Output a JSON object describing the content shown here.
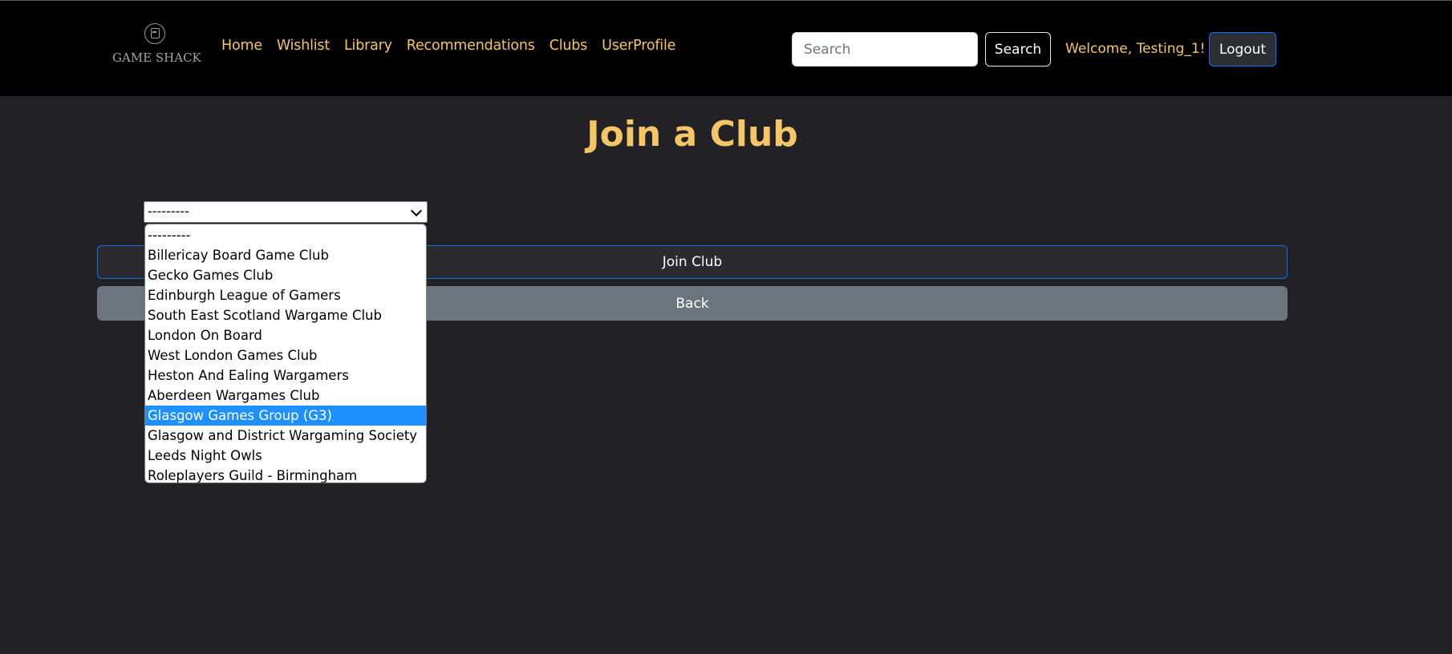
{
  "navbar": {
    "logo_text": "GAME SHACK",
    "links": [
      "Home",
      "Wishlist",
      "Library",
      "Recommendations",
      "Clubs",
      "UserProfile"
    ],
    "search_placeholder": "Search",
    "search_button": "Search",
    "welcome": "Welcome, Testing_1!",
    "logout": "Logout"
  },
  "main": {
    "title": "Join a Club",
    "select_value": "---------",
    "join_button": "Join Club",
    "back_button": "Back"
  },
  "dropdown": {
    "options": [
      "---------",
      "Billericay Board Game Club",
      "Gecko Games Club",
      "Edinburgh League of Gamers",
      "South East Scotland Wargame Club",
      "London On Board",
      "West London Games Club",
      "Heston And Ealing Wargamers",
      "Aberdeen Wargames Club",
      "Glasgow Games Group (G3)",
      "Glasgow and District Wargaming Society",
      "Leeds Night Owls",
      "Roleplayers Guild - Birmingham"
    ],
    "highlighted_option": "Glasgow Games Group (G3)"
  },
  "colors": {
    "accent": "#f5c566",
    "background": "#222125",
    "navbar": "#000000",
    "selection": "#1e90ff",
    "focus_border": "#0d6efd"
  },
  "icons": {
    "logo": "game-console-icon",
    "select_arrow": "chevron-down-icon"
  }
}
